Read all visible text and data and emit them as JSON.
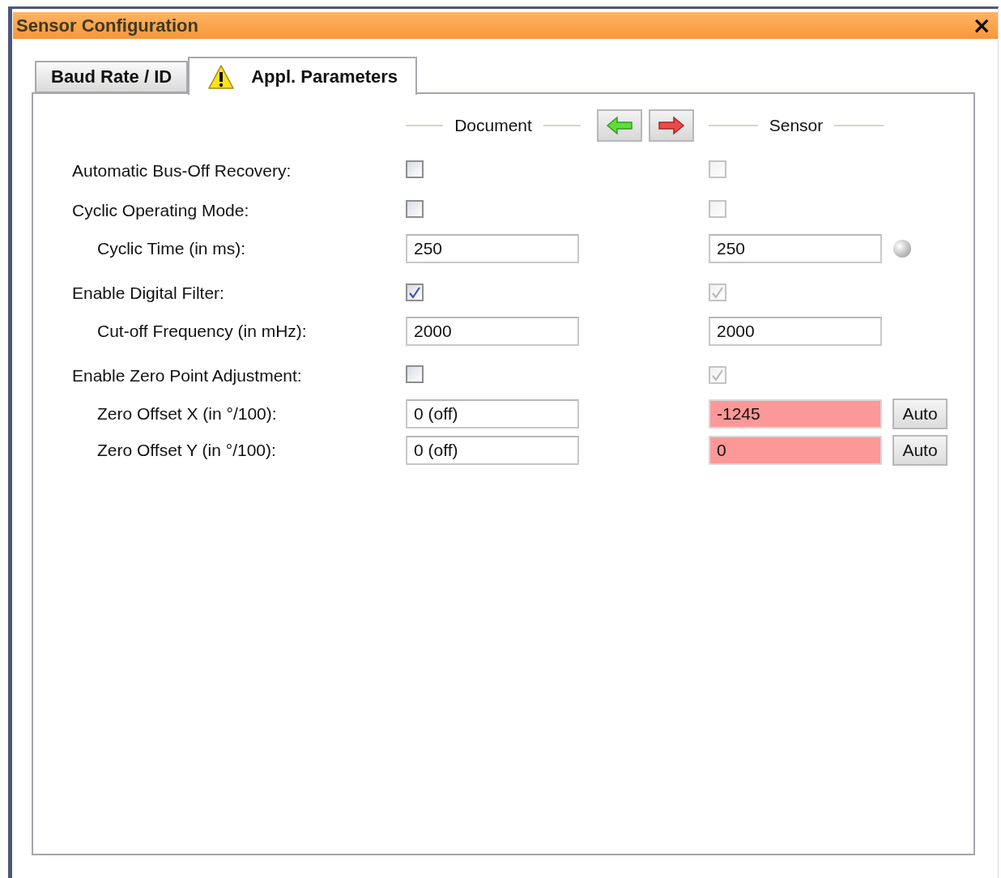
{
  "window": {
    "title": "Sensor Configuration",
    "close": "×"
  },
  "tabs": [
    {
      "label": "Baud Rate / ID",
      "selected": false,
      "warning": false
    },
    {
      "label": "Appl. Parameters",
      "selected": true,
      "warning": true
    }
  ],
  "columns": {
    "document": "Document",
    "sensor": "Sensor"
  },
  "rows": [
    {
      "kind": "check",
      "label": "Automatic Bus-Off Recovery:",
      "document": {
        "checked": false
      },
      "sensor": {
        "checked": false,
        "disabled": true
      }
    },
    {
      "kind": "check",
      "label": "Cyclic Operating Mode:",
      "document": {
        "checked": false
      },
      "sensor": {
        "checked": false,
        "disabled": true
      },
      "children": [
        {
          "kind": "field",
          "label": "Cyclic Time (in ms):",
          "document": {
            "value": "250"
          },
          "sensor": {
            "value": "250",
            "mismatch": false
          },
          "led": {
            "lit": false
          }
        }
      ]
    },
    {
      "kind": "check",
      "label": "Enable Digital Filter:",
      "document": {
        "checked": true
      },
      "sensor": {
        "checked": true,
        "disabled": true
      },
      "children": [
        {
          "kind": "field",
          "label": "Cut-off Frequency (in mHz):",
          "document": {
            "value": "2000"
          },
          "sensor": {
            "value": "2000",
            "mismatch": false
          }
        }
      ]
    },
    {
      "kind": "check",
      "label": "Enable Zero Point Adjustment:",
      "document": {
        "checked": false
      },
      "sensor": {
        "checked": true,
        "disabled": true
      },
      "children": [
        {
          "kind": "field",
          "label": "Zero Offset X (in °/100):",
          "document": {
            "value": "0 (off)"
          },
          "sensor": {
            "value": "-1245",
            "mismatch": true
          },
          "button": "Auto"
        },
        {
          "kind": "field",
          "label": "Zero Offset Y (in °/100):",
          "document": {
            "value": "0 (off)"
          },
          "sensor": {
            "value": "0",
            "mismatch": true
          },
          "button": "Auto"
        }
      ]
    }
  ]
}
